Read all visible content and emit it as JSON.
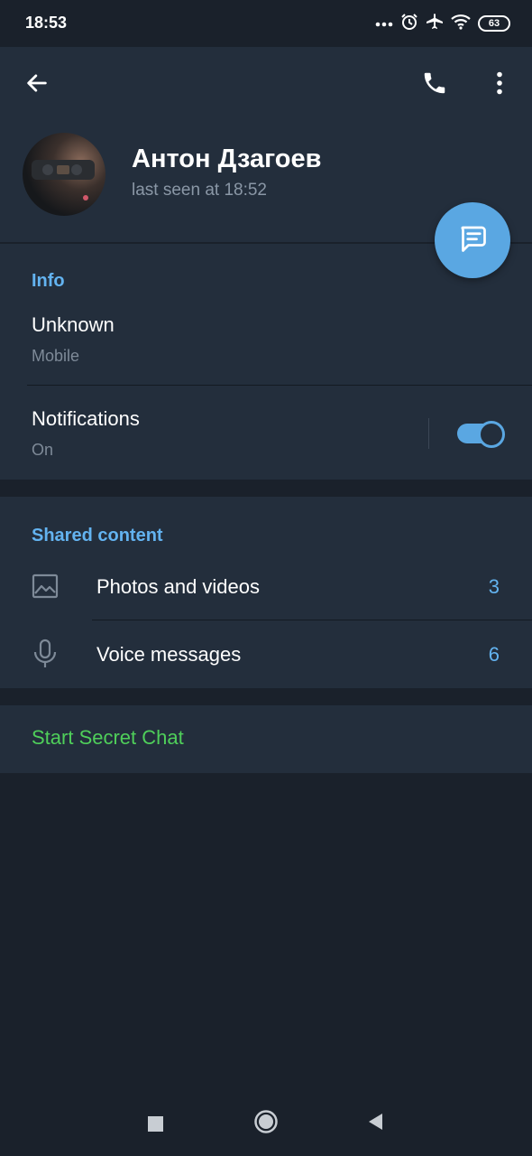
{
  "status_bar": {
    "time": "18:53",
    "icons": [
      "more-dots-icon",
      "alarm-icon",
      "airplane-icon",
      "wifi-icon",
      "battery-icon"
    ],
    "battery": "63"
  },
  "header": {
    "icons": [
      "back-arrow-icon",
      "phone-icon",
      "more-vert-icon"
    ],
    "name": "Антон Дзагоев",
    "last_seen": "last seen at 18:52",
    "fab_icon": "message-icon"
  },
  "info": {
    "title": "Info",
    "phone_value": "Unknown",
    "phone_label": "Mobile",
    "notifications_label": "Notifications",
    "notifications_value": "On",
    "notifications_enabled": true
  },
  "shared": {
    "title": "Shared content",
    "items": [
      {
        "icon": "photo-icon",
        "label": "Photos and videos",
        "count": "3"
      },
      {
        "icon": "microphone-icon",
        "label": "Voice messages",
        "count": "6"
      }
    ]
  },
  "secret_chat": {
    "label": "Start Secret Chat"
  },
  "colors": {
    "background": "#1a212b",
    "surface": "#232e3c",
    "accent": "#5aa7e2",
    "section_title": "#63b3f0",
    "secret_green": "#4fcf5a"
  },
  "nav_bar": {
    "icons": [
      "recents-square-icon",
      "home-circle-icon",
      "back-triangle-icon"
    ]
  }
}
